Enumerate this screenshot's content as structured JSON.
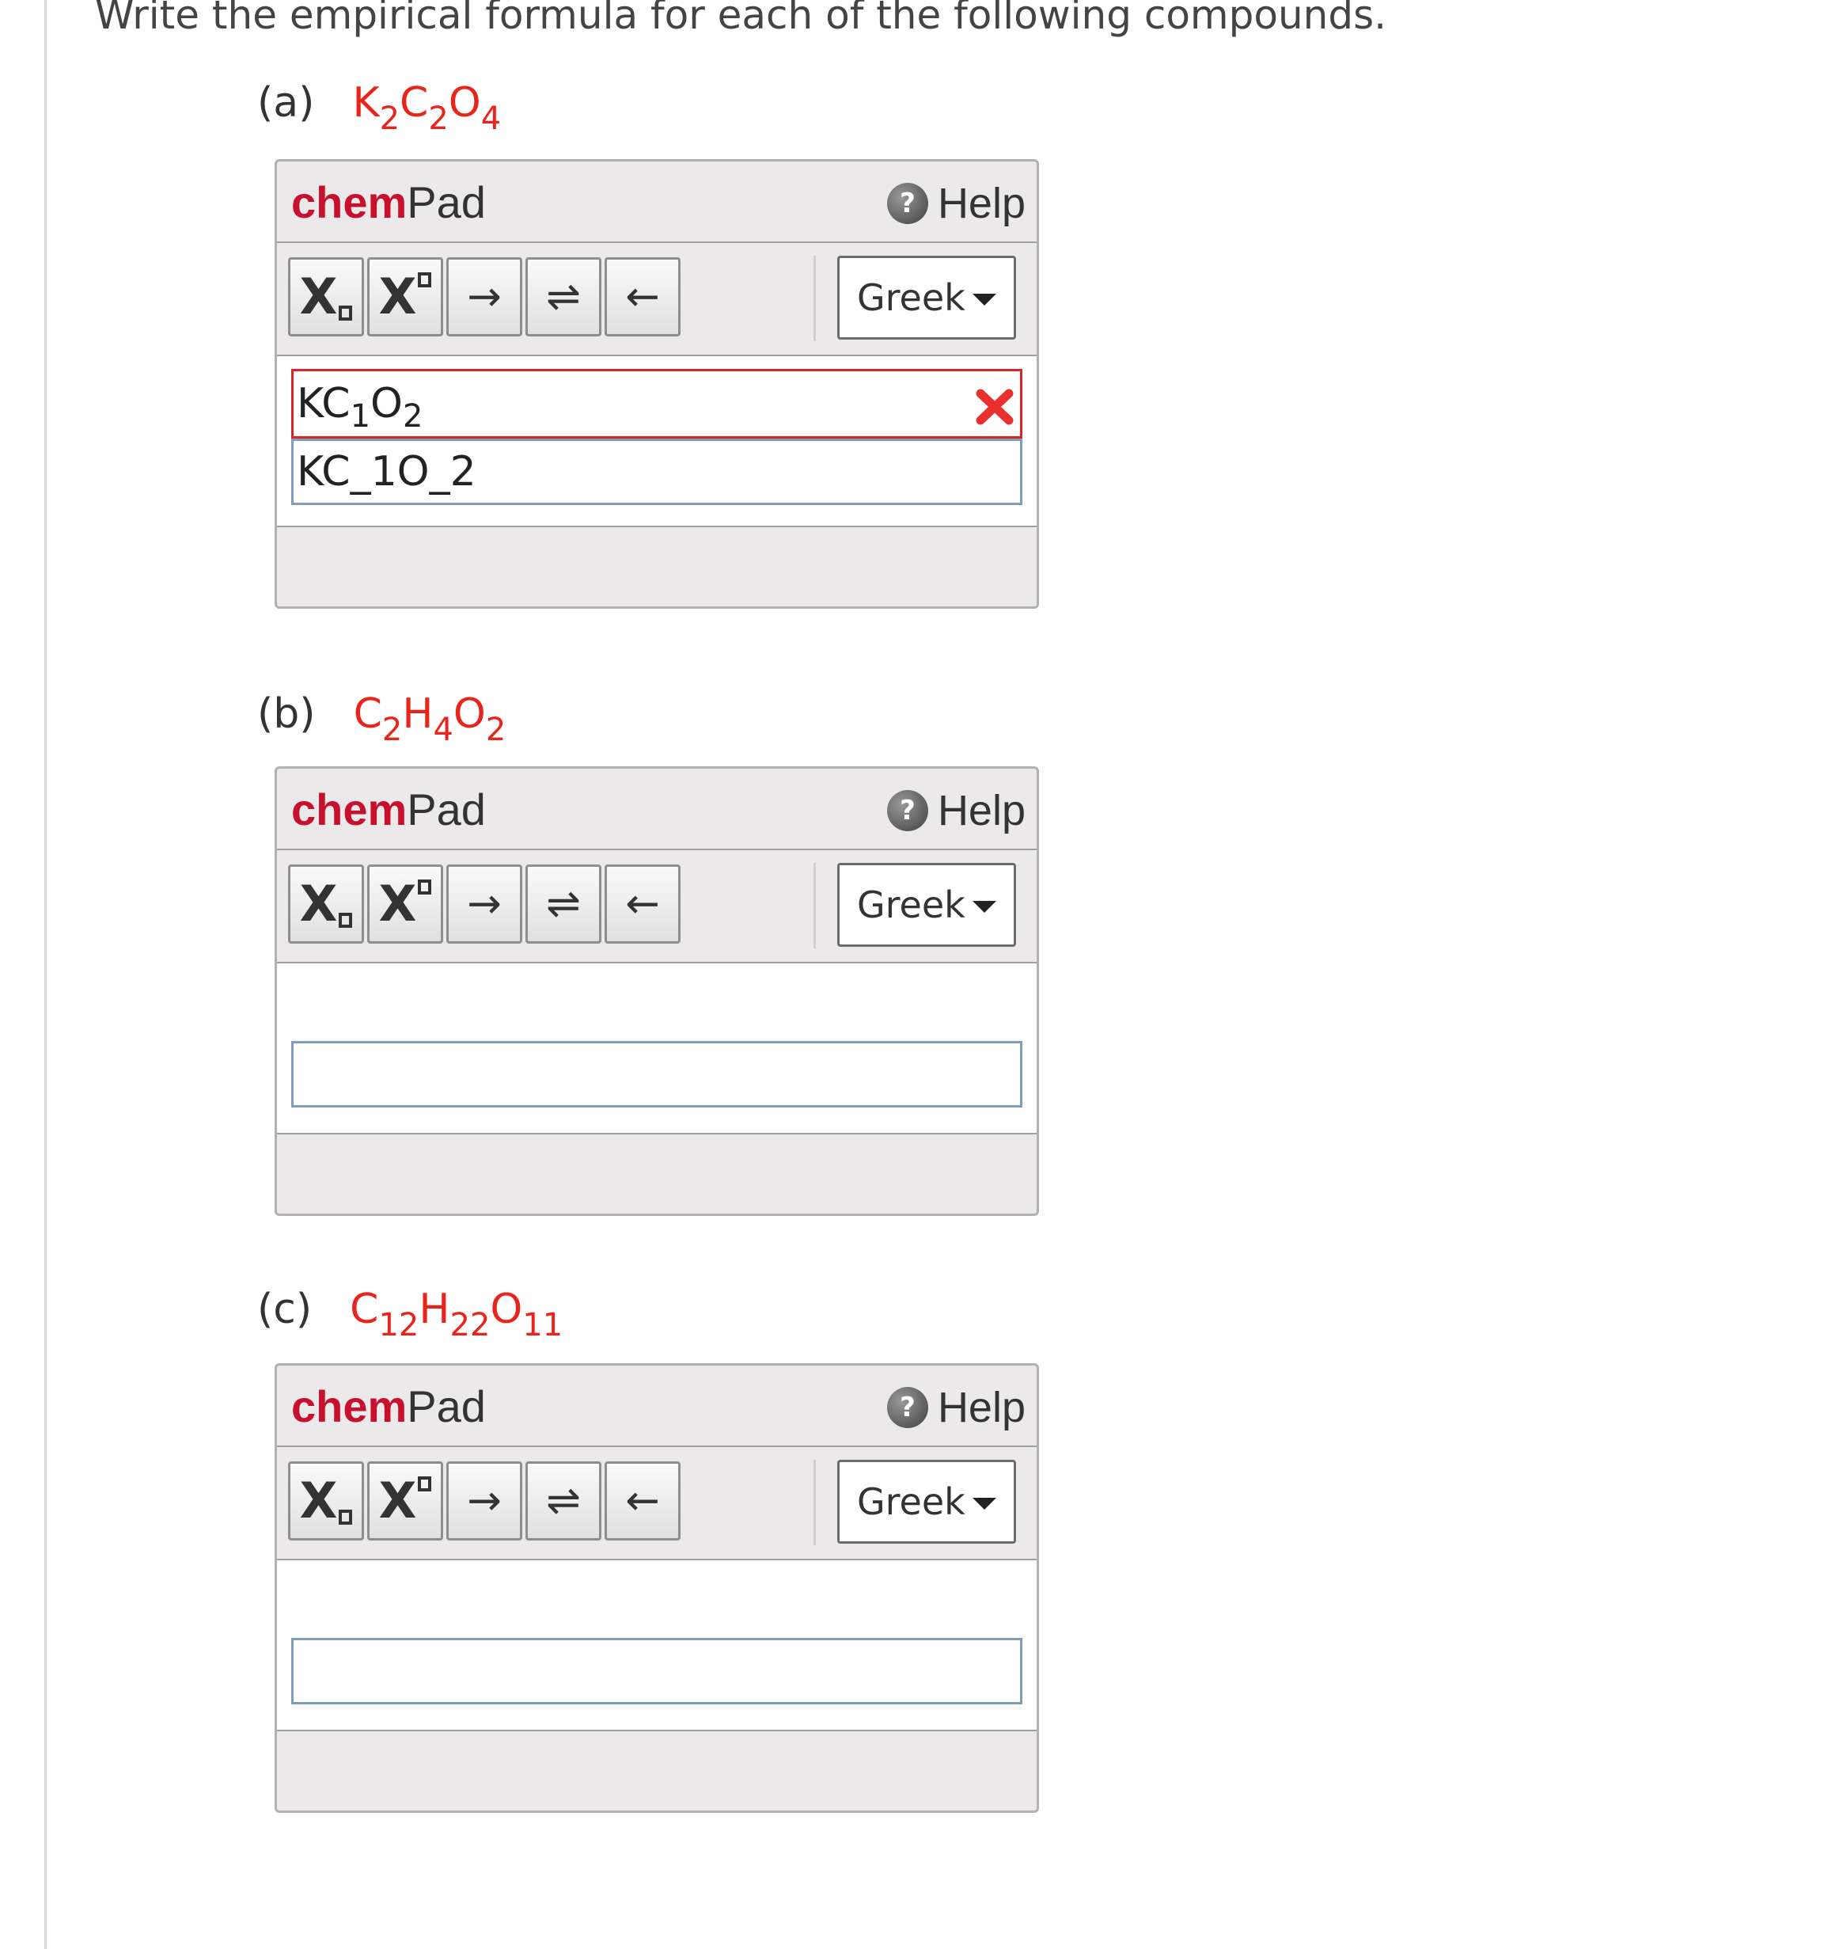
{
  "instructions": "Write the empirical formula for each of the following compounds.",
  "questions": [
    {
      "label": "(a)",
      "formula": [
        [
          "K",
          "2"
        ],
        [
          "C",
          "2"
        ],
        [
          "O",
          "4"
        ]
      ]
    },
    {
      "label": "(b)",
      "formula": [
        [
          "C",
          "2"
        ],
        [
          "H",
          "4"
        ],
        [
          "O",
          "2"
        ]
      ]
    },
    {
      "label": "(c)",
      "formula": [
        [
          "C",
          "12"
        ],
        [
          "H",
          "22"
        ],
        [
          "O",
          "11"
        ]
      ]
    }
  ],
  "chempad": {
    "title_bold": "chem",
    "title_rest": "Pad",
    "help_icon_glyph": "?",
    "help_label": "Help",
    "toolbar": {
      "subscript": {
        "icon": "subscript-icon",
        "glyph": "X"
      },
      "superscript": {
        "icon": "superscript-icon",
        "glyph": "X"
      },
      "reaction_arrow": {
        "icon": "right-arrow-icon",
        "glyph": "→"
      },
      "equilibrium_arrow": {
        "icon": "equilibrium-arrow-icon",
        "glyph": "⇌"
      },
      "left_arrow": {
        "icon": "left-arrow-icon",
        "glyph": "←"
      }
    },
    "greek_label": "Greek"
  },
  "answers": {
    "a": {
      "rendered": [
        [
          "K",
          ""
        ],
        [
          "C",
          "1"
        ],
        [
          "O",
          "2"
        ]
      ],
      "raw": "KC_1O_2",
      "status": "incorrect"
    },
    "b": {
      "raw": ""
    },
    "c": {
      "raw": ""
    }
  },
  "colors": {
    "accent_red": "#c8102e",
    "formula_red": "#e8241b",
    "error_red": "#d8242a",
    "input_border": "#7f9db9"
  }
}
